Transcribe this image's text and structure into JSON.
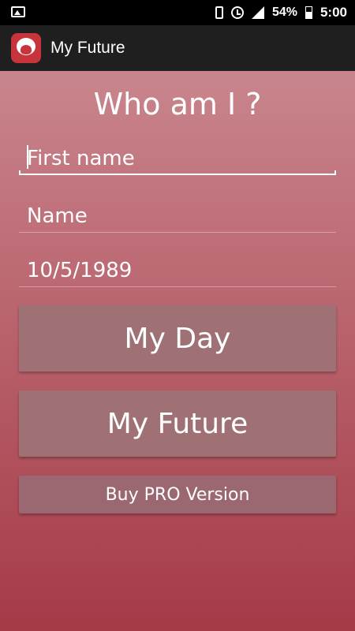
{
  "status_bar": {
    "battery_percent": "54%",
    "time": "5:00"
  },
  "app_bar": {
    "title": "My Future"
  },
  "main": {
    "title": "Who am I ?",
    "fields": {
      "first_name_placeholder": "First name",
      "name_placeholder": "Name",
      "date_value": "10/5/1989"
    },
    "buttons": {
      "my_day": "My Day",
      "my_future": "My Future",
      "buy_pro": "Buy PRO Version"
    }
  },
  "colors": {
    "gradient_top": "#c9858d",
    "gradient_bottom": "#a53a47",
    "button_bg": "#9f7174",
    "app_bar_bg": "#1f1f1f"
  }
}
